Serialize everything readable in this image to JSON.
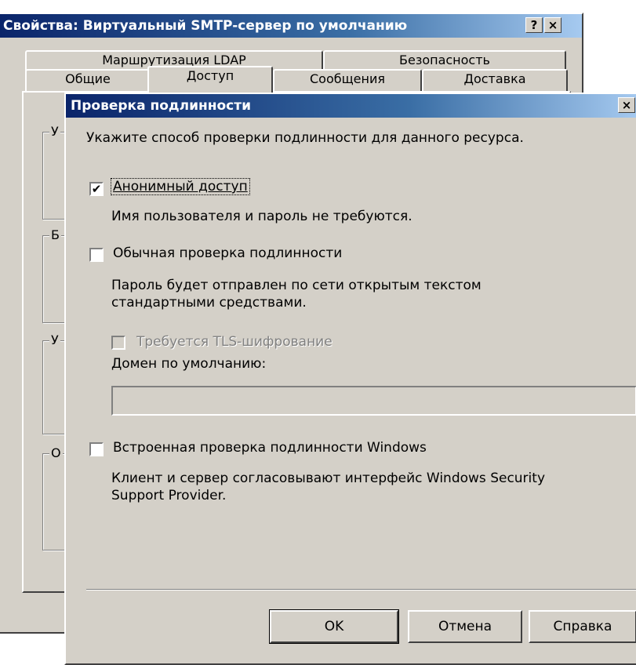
{
  "back_window": {
    "title": "Свойства: Виртуальный SMTP-сервер по умолчанию",
    "help_button": "?",
    "close_button": "×",
    "tabs_row1": [
      {
        "label": "Маршрутизация LDAP"
      },
      {
        "label": "Безопасность"
      }
    ],
    "tabs_row2": [
      {
        "label": "Общие"
      },
      {
        "label": "Доступ"
      },
      {
        "label": "Сообщения"
      },
      {
        "label": "Доставка"
      }
    ],
    "group_initials": [
      "У",
      "Б",
      "У",
      "О"
    ]
  },
  "dialog": {
    "title": "Проверка подлинности",
    "close_button": "×",
    "instruction": "Укажите способ проверки подлинности для данного ресурса.",
    "anonymous": {
      "label": "Анонимный доступ",
      "checked": true,
      "description": "Имя пользователя и пароль не требуются."
    },
    "basic": {
      "label": "Обычная проверка подлинности",
      "checked": false,
      "description_line1": "Пароль будет отправлен по сети открытым текстом",
      "description_line2": "стандартными средствами.",
      "tls": {
        "label": "Требуется TLS-шифрование",
        "checked": false,
        "enabled": false
      },
      "domain_label": "Домен по умолчанию:",
      "domain_value": ""
    },
    "integrated": {
      "label": "Встроенная проверка подлинности Windows",
      "checked": false,
      "description_line1": "Клиент и сервер согласовывают интерфейс Windows Security",
      "description_line2": "Support Provider."
    },
    "buttons": {
      "ok": "OK",
      "cancel": "Отмена",
      "help": "Справка"
    }
  }
}
